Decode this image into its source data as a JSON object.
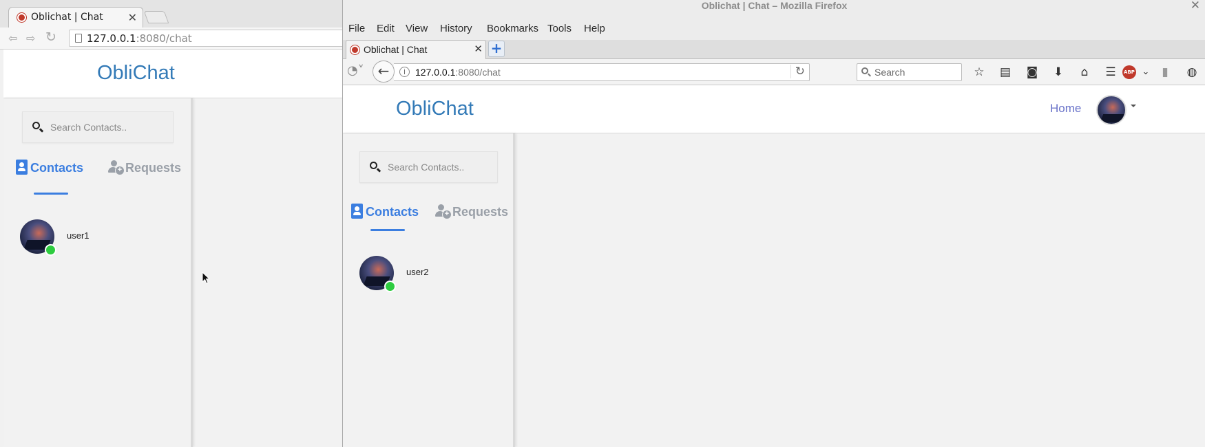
{
  "left_browser": {
    "tab_title": "Oblichat | Chat",
    "tab_close": "✕",
    "url_host": "127.0.0.1",
    "url_path": ":8080/chat",
    "page": {
      "brand": "ObliChat",
      "search_placeholder": "Search Contacts..",
      "tabs": {
        "contacts": "Contacts",
        "requests": "Requests"
      },
      "contacts": [
        {
          "name": "user1",
          "online": true
        }
      ]
    }
  },
  "right_browser": {
    "window_title": "Oblichat | Chat – Mozilla Firefox",
    "window_close": "✕",
    "menu": [
      "File",
      "Edit",
      "View",
      "History",
      "Bookmarks",
      "Tools",
      "Help"
    ],
    "tab_title": "Oblichat | Chat",
    "tab_close": "✕",
    "new_tab": "+",
    "url_host": "127.0.0.1",
    "url_path": ":8080/chat",
    "search_placeholder": "Search",
    "abp_label": "ABP",
    "page": {
      "brand": "ObliChat",
      "nav_home": "Home",
      "search_placeholder": "Search Contacts..",
      "tabs": {
        "contacts": "Contacts",
        "requests": "Requests"
      },
      "contacts": [
        {
          "name": "user2",
          "online": true
        }
      ]
    }
  },
  "colors": {
    "brand": "#337ab7",
    "active_tab": "#3b7ee0",
    "inactive_tab": "#9aa0a8",
    "online": "#2ecc40",
    "home_link": "#6a73c9"
  },
  "icons": {
    "search": "search-icon",
    "contacts": "address-book-icon",
    "requests": "add-user-icon",
    "back": "back-arrow-icon",
    "forward": "forward-arrow-icon",
    "reload": "reload-icon",
    "bookmark": "star-icon",
    "reading_list": "clipboard-icon",
    "pocket": "pocket-icon",
    "download": "download-icon",
    "home": "home-icon",
    "menu": "hamburger-menu-icon"
  }
}
